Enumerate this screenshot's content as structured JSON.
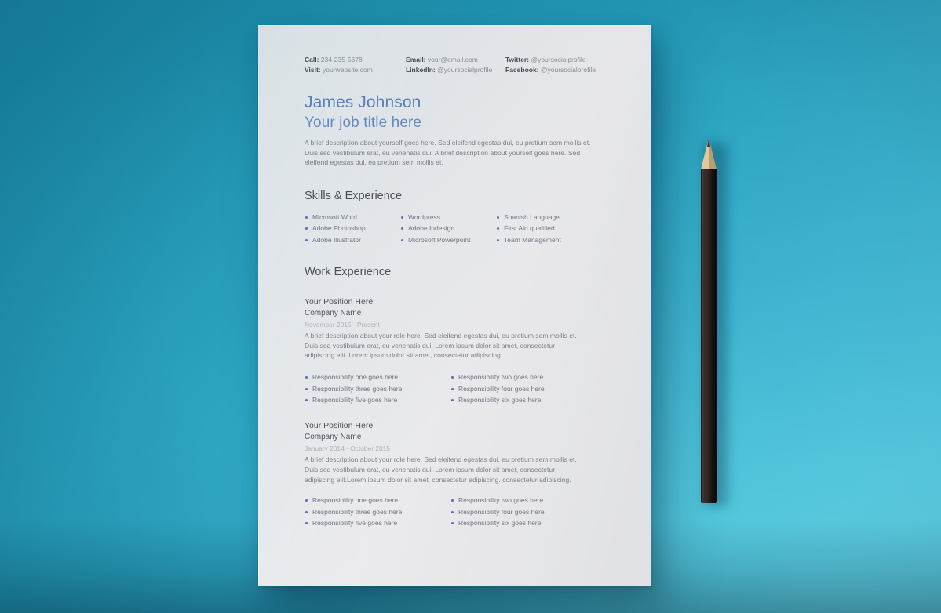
{
  "scene": {
    "background_top_left": "#1f95b4",
    "background_bottom_right": "#4ec8de",
    "paper_color": "#e9e9ec",
    "accent_blue": "#5a7eb8",
    "bullet_color": "#5b6fae",
    "pencil_color": "#1a1412",
    "pencil_tip_color": "#e3c79c"
  },
  "resume": {
    "contact": {
      "columns": [
        [
          {
            "label": "Call:",
            "value": "234-235-5678"
          },
          {
            "label": "Visit:",
            "value": "yourwebsite.com"
          }
        ],
        [
          {
            "label": "Email:",
            "value": "your@email.com"
          },
          {
            "label": "LinkedIn:",
            "value": "@yoursocialprofile"
          }
        ],
        [
          {
            "label": "Twitter:",
            "value": "@yoursocialprofile"
          },
          {
            "label": "Facebook:",
            "value": "@yoursocialprofile"
          }
        ]
      ]
    },
    "name": "James Johnson",
    "job_title": "Your job title here",
    "intro": "A brief description about yourself goes here. Sed eleifend egestas dui, eu pretium sem mollis et. Duis sed vestibulum erat, eu venenatis dui. A brief description about yourself goes here. Sed eleifend egestas dui, eu pretium sem mollis et.",
    "skills_heading": "Skills & Experience",
    "skills_columns": [
      [
        "Microsoft Word",
        "Adobe Photoshop",
        "Adobe Illustrator"
      ],
      [
        "Wordpress",
        "Adobe Indesign",
        "Microsoft Powerpoint"
      ],
      [
        "Spanish Language",
        "First Aid qualified",
        "Team Management"
      ]
    ],
    "work_heading": "Work Experience",
    "jobs": [
      {
        "position": "Your Position Here",
        "company": "Company Name",
        "dates": "November 2015 - Present",
        "description": "A brief description about your role here. Sed eleifend egestas dui, eu pretium sem mollis et. Duis sed vestibulum erat, eu venenatis dui. Lorem ipsum dolor sit amet, consectetur adipiscing elit. Lorem ipsum dolor sit amet, consectetur adipiscing.",
        "responsibilities_columns": [
          [
            "Responsibility one goes here",
            "Responsibility three goes here",
            "Responsibility five goes here"
          ],
          [
            "Responsibility two goes here",
            "Responsibility four goes here",
            "Responsibility six goes here"
          ]
        ]
      },
      {
        "position": "Your Position Here",
        "company": "Company Name",
        "dates": "January 2014 - October 2015",
        "description": "A brief description about your role here. Sed eleifend egestas dui, eu pretium sem mollis et. Duis sed vestibulum erat, eu venenatis dui. Lorem ipsum dolor sit amet, consectetur adipiscing elit.Lorem ipsum dolor sit amet, consectetur adipiscing. consectetur adipiscing.",
        "responsibilities_columns": [
          [
            "Responsibility one goes here",
            "Responsibility three goes here",
            "Responsibility five goes here"
          ],
          [
            "Responsibility two goes here",
            "Responsibility four goes here",
            "Responsibility six goes here"
          ]
        ]
      }
    ]
  }
}
